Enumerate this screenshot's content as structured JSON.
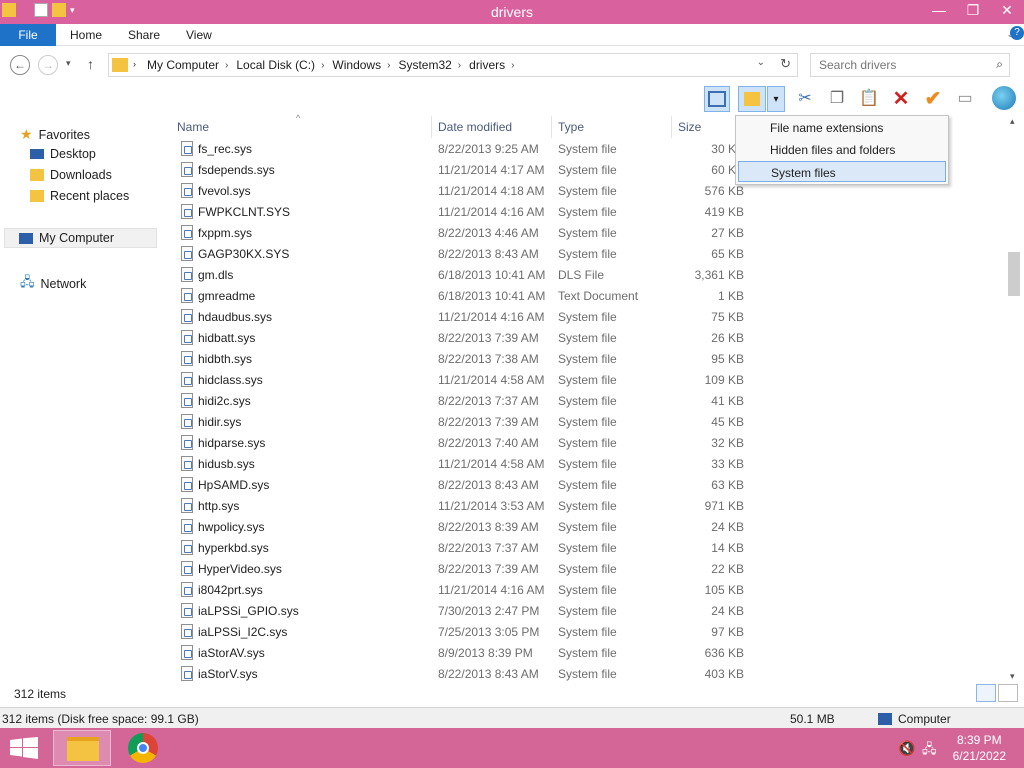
{
  "window": {
    "title": "drivers"
  },
  "ribbon": {
    "tabs": [
      "File",
      "Home",
      "Share",
      "View"
    ]
  },
  "address": {
    "crumbs": [
      "My Computer",
      "Local Disk (C:)",
      "Windows",
      "System32",
      "drivers"
    ],
    "search_placeholder": "Search drivers"
  },
  "nav": {
    "favorites": "Favorites",
    "desktop": "Desktop",
    "downloads": "Downloads",
    "recent": "Recent places",
    "computer": "My Computer",
    "network": "Network"
  },
  "columns": {
    "name": "Name",
    "date": "Date modified",
    "type": "Type",
    "size": "Size"
  },
  "files": [
    {
      "name": "fs_rec.sys",
      "date": "8/22/2013 9:25 AM",
      "type": "System file",
      "size": "30 KB"
    },
    {
      "name": "fsdepends.sys",
      "date": "11/21/2014 4:17 AM",
      "type": "System file",
      "size": "60 KB"
    },
    {
      "name": "fvevol.sys",
      "date": "11/21/2014 4:18 AM",
      "type": "System file",
      "size": "576 KB"
    },
    {
      "name": "FWPKCLNT.SYS",
      "date": "11/21/2014 4:16 AM",
      "type": "System file",
      "size": "419 KB"
    },
    {
      "name": "fxppm.sys",
      "date": "8/22/2013 4:46 AM",
      "type": "System file",
      "size": "27 KB"
    },
    {
      "name": "GAGP30KX.SYS",
      "date": "8/22/2013 8:43 AM",
      "type": "System file",
      "size": "65 KB"
    },
    {
      "name": "gm.dls",
      "date": "6/18/2013 10:41 AM",
      "type": "DLS File",
      "size": "3,361 KB"
    },
    {
      "name": "gmreadme",
      "date": "6/18/2013 10:41 AM",
      "type": "Text Document",
      "size": "1 KB"
    },
    {
      "name": "hdaudbus.sys",
      "date": "11/21/2014 4:16 AM",
      "type": "System file",
      "size": "75 KB"
    },
    {
      "name": "hidbatt.sys",
      "date": "8/22/2013 7:39 AM",
      "type": "System file",
      "size": "26 KB"
    },
    {
      "name": "hidbth.sys",
      "date": "8/22/2013 7:38 AM",
      "type": "System file",
      "size": "95 KB"
    },
    {
      "name": "hidclass.sys",
      "date": "11/21/2014 4:58 AM",
      "type": "System file",
      "size": "109 KB"
    },
    {
      "name": "hidi2c.sys",
      "date": "8/22/2013 7:37 AM",
      "type": "System file",
      "size": "41 KB"
    },
    {
      "name": "hidir.sys",
      "date": "8/22/2013 7:39 AM",
      "type": "System file",
      "size": "45 KB"
    },
    {
      "name": "hidparse.sys",
      "date": "8/22/2013 7:40 AM",
      "type": "System file",
      "size": "32 KB"
    },
    {
      "name": "hidusb.sys",
      "date": "11/21/2014 4:58 AM",
      "type": "System file",
      "size": "33 KB"
    },
    {
      "name": "HpSAMD.sys",
      "date": "8/22/2013 8:43 AM",
      "type": "System file",
      "size": "63 KB"
    },
    {
      "name": "http.sys",
      "date": "11/21/2014 3:53 AM",
      "type": "System file",
      "size": "971 KB"
    },
    {
      "name": "hwpolicy.sys",
      "date": "8/22/2013 8:39 AM",
      "type": "System file",
      "size": "24 KB"
    },
    {
      "name": "hyperkbd.sys",
      "date": "8/22/2013 7:37 AM",
      "type": "System file",
      "size": "14 KB"
    },
    {
      "name": "HyperVideo.sys",
      "date": "8/22/2013 7:39 AM",
      "type": "System file",
      "size": "22 KB"
    },
    {
      "name": "i8042prt.sys",
      "date": "11/21/2014 4:16 AM",
      "type": "System file",
      "size": "105 KB"
    },
    {
      "name": "iaLPSSi_GPIO.sys",
      "date": "7/30/2013 2:47 PM",
      "type": "System file",
      "size": "24 KB"
    },
    {
      "name": "iaLPSSi_I2C.sys",
      "date": "7/25/2013 3:05 PM",
      "type": "System file",
      "size": "97 KB"
    },
    {
      "name": "iaStorAV.sys",
      "date": "8/9/2013 8:39 PM",
      "type": "System file",
      "size": "636 KB"
    },
    {
      "name": "iaStorV.sys",
      "date": "8/22/2013 8:43 AM",
      "type": "System file",
      "size": "403 KB"
    }
  ],
  "menu": {
    "items": [
      "File name extensions",
      "Hidden files and folders",
      "System files"
    ]
  },
  "status": {
    "count": "312 items",
    "detail": "312 items (Disk free space: 99.1 GB)",
    "size": "50.1 MB",
    "location": "Computer"
  },
  "clock": {
    "time": "8:39 PM",
    "date": "6/21/2022"
  }
}
